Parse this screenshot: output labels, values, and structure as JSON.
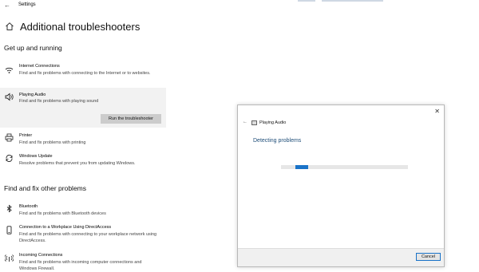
{
  "app": {
    "title": "Settings"
  },
  "page": {
    "title": "Additional troubleshooters"
  },
  "sections": {
    "running": {
      "title": "Get up and running",
      "items": [
        {
          "name": "Internet Connections",
          "desc": "Find and fix problems with connecting to the Internet or to websites.",
          "icon": "wifi-icon"
        },
        {
          "name": "Playing Audio",
          "desc": "Find and fix problems with playing sound",
          "icon": "speaker-icon",
          "selected": true,
          "action": "Run the troubleshooter"
        },
        {
          "name": "Printer",
          "desc": "Find and fix problems with printing",
          "icon": "printer-icon"
        },
        {
          "name": "Windows Update",
          "desc": "Resolve problems that prevent you from updating Windows.",
          "icon": "sync-icon"
        }
      ]
    },
    "other": {
      "title": "Find and fix other problems",
      "items": [
        {
          "name": "Bluetooth",
          "desc": "Find and fix problems with Bluetooth devices",
          "icon": "bluetooth-icon"
        },
        {
          "name": "Connection to a Workplace Using DirectAccess",
          "desc": "Find and fix problems with connecting to your workplace network using DirectAccess.",
          "icon": "device-icon"
        },
        {
          "name": "Incoming Connections",
          "desc": "Find and fix problems with incoming computer connections and Windows Firewall.",
          "icon": "signal-icon"
        }
      ]
    }
  },
  "dialog": {
    "title": "Playing Audio",
    "heading": "Detecting problems",
    "cancel_label": "Cancel",
    "progress": {
      "type": "indeterminate"
    }
  },
  "colors": {
    "accent": "#1a73c8",
    "selected_bg": "#f2f2f2",
    "button_bg": "#cccccc",
    "heading_blue": "#1f4e79"
  }
}
